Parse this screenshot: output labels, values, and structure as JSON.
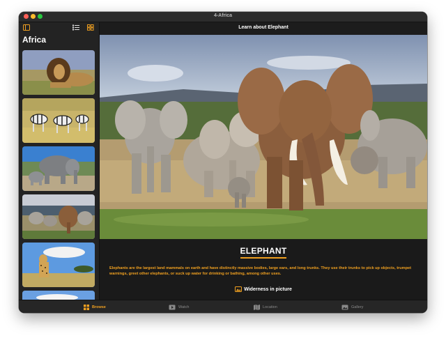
{
  "window": {
    "title": "4-Africa"
  },
  "sidebar": {
    "title": "Africa",
    "thumbnails": [
      "Lion",
      "Zebras",
      "Elephants with calf",
      "Elephant herd",
      "Cheetah",
      "Landscape"
    ]
  },
  "content": {
    "header_title": "Learn about Elephant",
    "heading": "ELEPHANT",
    "description": "Elephants are the largest land mammals on earth and have distinctly massive bodies, large ears, and long trunks. They use their trunks to pick up objects, trumpet warnings, greet other elephants, or suck up water for drinking or bathing, among other uses.",
    "link_label": "Widerness in picture"
  },
  "tabs": [
    {
      "label": "Browse",
      "icon": "grid-icon",
      "active": true
    },
    {
      "label": "Watch",
      "icon": "play-icon",
      "active": false
    },
    {
      "label": "Location",
      "icon": "map-icon",
      "active": false
    },
    {
      "label": "Gallery",
      "icon": "photo-icon",
      "active": false
    }
  ],
  "colors": {
    "accent": "#f0a020",
    "background": "#1e1e1e"
  }
}
